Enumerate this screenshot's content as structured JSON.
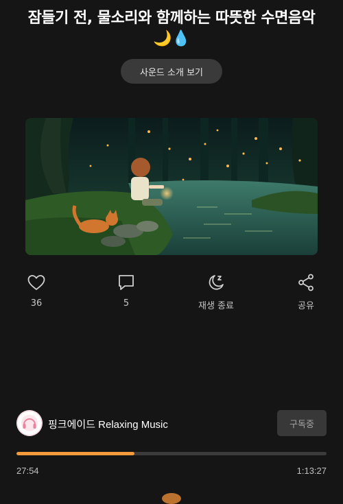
{
  "header": {
    "title": "잠들기 전, 물소리와 함께하는 따뜻한 수면음악 🌙💧"
  },
  "intro_button": {
    "label": "사운드 소개 보기"
  },
  "actions": {
    "like": {
      "count": "36",
      "icon": "heart-icon"
    },
    "comment": {
      "count": "5",
      "icon": "comment-icon"
    },
    "sleep_timer": {
      "label": "재생 종료",
      "icon": "moon-zz-icon"
    },
    "share": {
      "label": "공유",
      "icon": "share-icon"
    }
  },
  "channel": {
    "name": "핑크에이드 Relaxing Music",
    "subscribe_label": "구독중"
  },
  "player": {
    "current_time": "27:54",
    "total_time": "1:13:27",
    "progress": 0.38,
    "accent_color": "#f29a3c"
  },
  "colors": {
    "background": "#151515",
    "button": "#3a3a3a"
  }
}
